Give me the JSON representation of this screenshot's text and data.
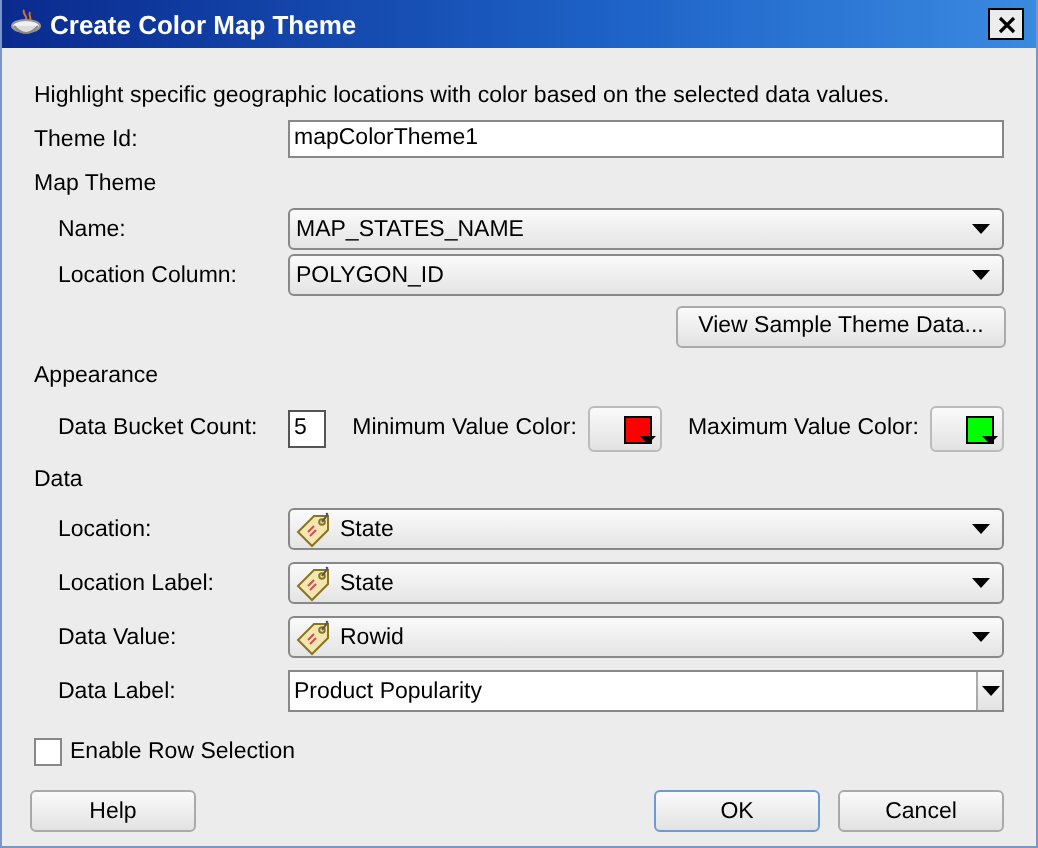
{
  "window": {
    "title": "Create Color Map Theme"
  },
  "description": "Highlight specific geographic locations with color based on the selected data values.",
  "theme_id": {
    "label": "Theme Id:",
    "value": "mapColorTheme1"
  },
  "map_theme": {
    "heading": "Map Theme",
    "fields": [
      {
        "label": "Name:",
        "value": "MAP_STATES_NAME",
        "kind": "combo"
      },
      {
        "label": "Location Column:",
        "value": "POLYGON_ID",
        "kind": "combo"
      }
    ],
    "button": "View Sample Theme Data..."
  },
  "appearance": {
    "heading": "Appearance",
    "bucket_count": {
      "label": "Data Bucket Count:",
      "value": "5"
    },
    "colors": [
      {
        "label": "Minimum Value Color:",
        "color": "#ff0000"
      },
      {
        "label": "Maximum Value Color:",
        "color": "#00ff00"
      }
    ]
  },
  "data": {
    "heading": "Data",
    "fields": [
      {
        "label": "Location:",
        "value": "State",
        "kind": "tag-combo"
      },
      {
        "label": "Location Label:",
        "value": "State",
        "kind": "tag-combo"
      },
      {
        "label": "Data Value:",
        "value": "Rowid",
        "kind": "tag-combo"
      },
      {
        "label": "Data Label:",
        "value": "Product Popularity",
        "kind": "editable-combo"
      }
    ]
  },
  "enable_row_selection": {
    "label": "Enable Row Selection",
    "checked": false
  },
  "buttons": [
    {
      "label": "Help",
      "default": false
    },
    {
      "label": "OK",
      "default": true
    },
    {
      "label": "Cancel",
      "default": false
    }
  ]
}
